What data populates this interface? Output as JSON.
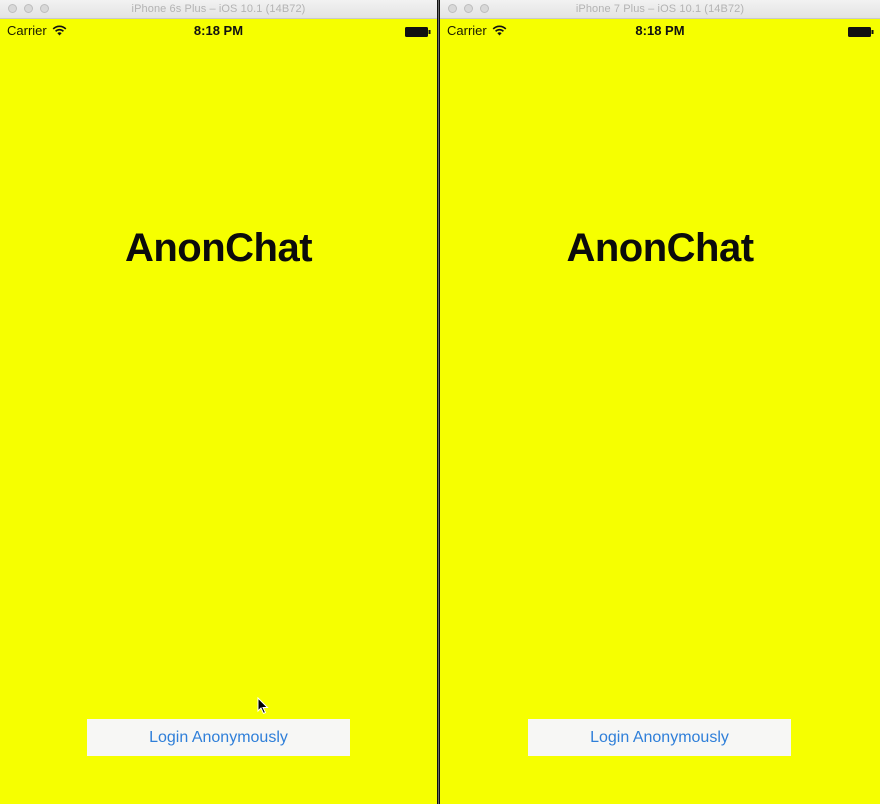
{
  "simulators": [
    {
      "window_title": "iPhone 6s Plus – iOS 10.1 (14B72)",
      "status": {
        "carrier": "Carrier",
        "time": "8:18 PM"
      },
      "app": {
        "title": "AnonChat",
        "login_label": "Login Anonymously"
      }
    },
    {
      "window_title": "iPhone 7 Plus – iOS 10.1 (14B72)",
      "status": {
        "carrier": "Carrier",
        "time": "8:18 PM"
      },
      "app": {
        "title": "AnonChat",
        "login_label": "Login Anonymously"
      }
    }
  ],
  "colors": {
    "background": "#f6ff00",
    "button_background": "#f7f7f5",
    "button_text": "#2f7fd9",
    "title_text": "#0b0b0b"
  },
  "icons": [
    "wifi-icon",
    "battery-icon",
    "cursor-icon"
  ]
}
